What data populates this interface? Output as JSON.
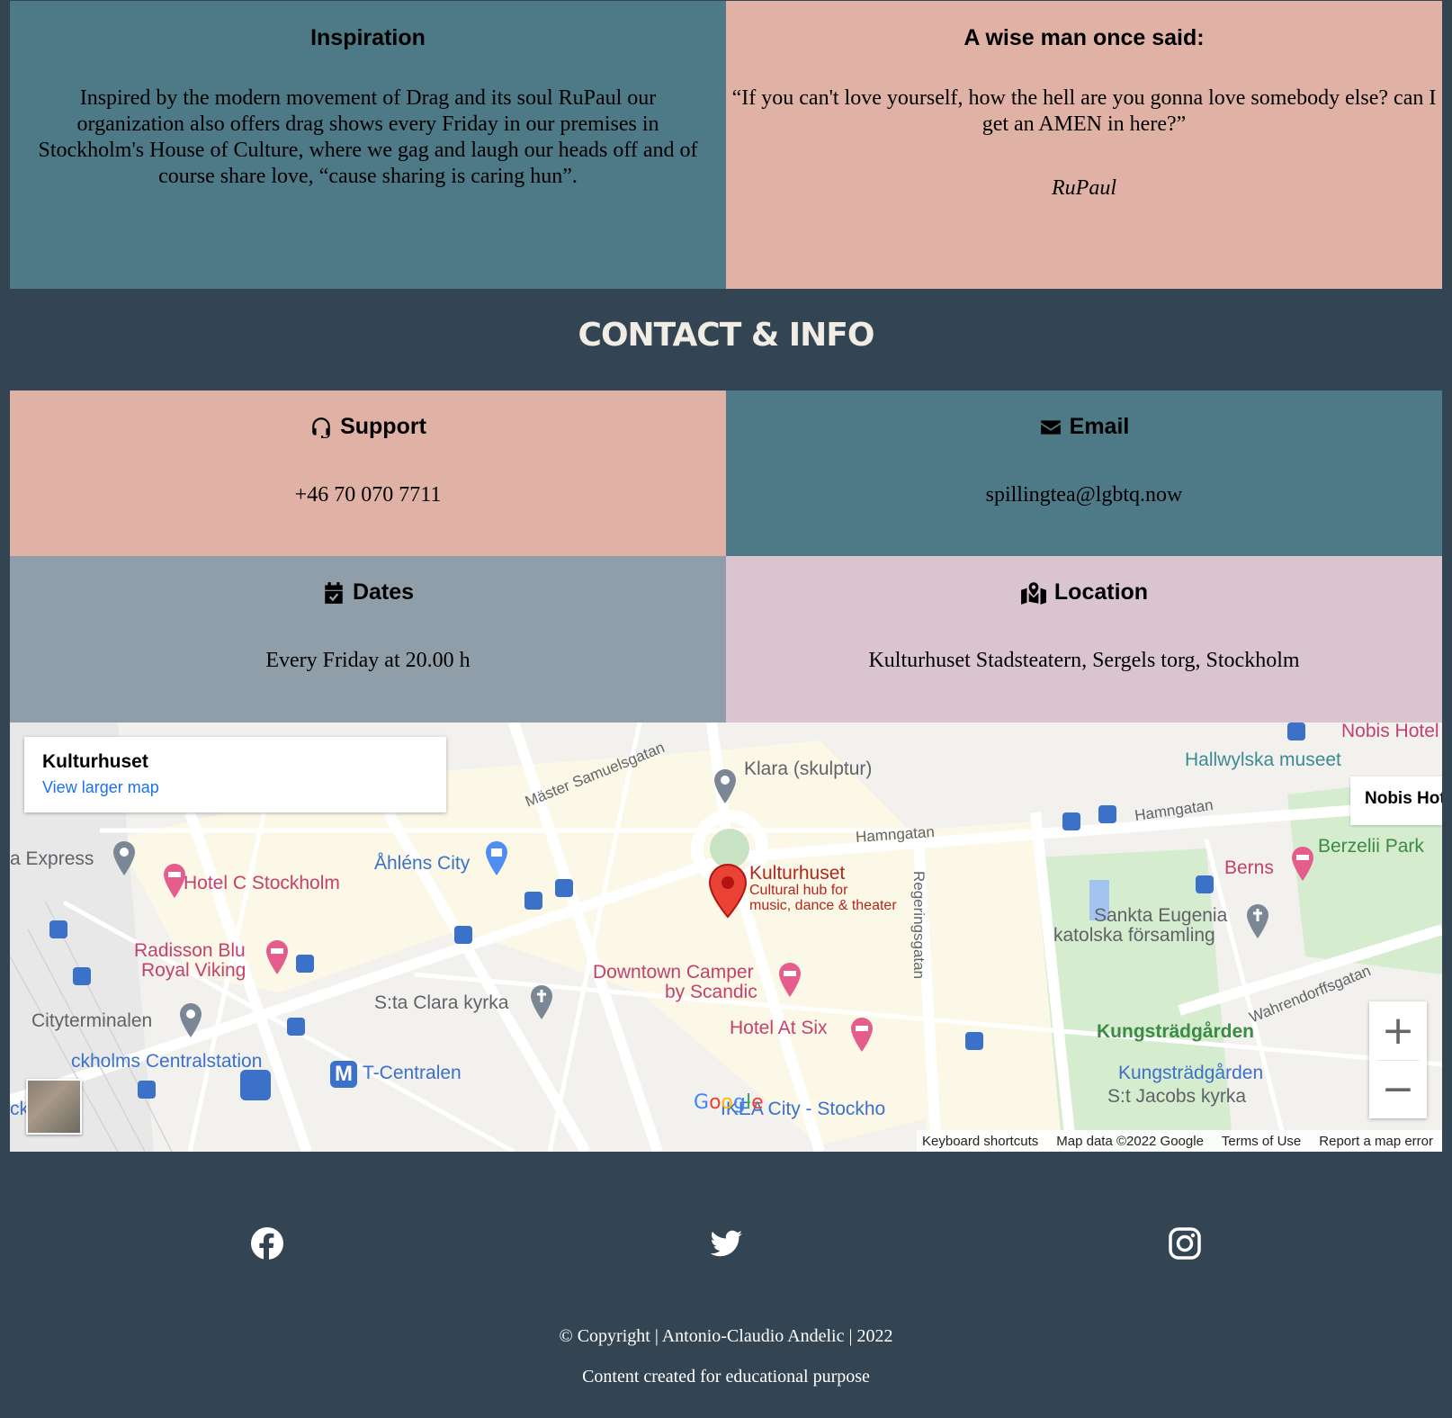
{
  "inspiration": {
    "title": "Inspiration",
    "text": "Inspired by the modern movement of Drag and its soul RuPaul our organization also offers drag shows every Friday in our premises in Stockholm's House of Culture, where we gag and laugh our heads off and of course share love, “cause sharing is caring hun”."
  },
  "quote": {
    "title": "A wise man once said:",
    "text": "“If you can't love yourself, how the hell are you gonna love somebody else? can I get an AMEN in here?”",
    "author": "RuPaul"
  },
  "contact": {
    "title": "CONTACT & INFO",
    "support": {
      "title": "Support",
      "value": "+46 70 070 7711",
      "icon": "headset-icon"
    },
    "email": {
      "title": "Email",
      "value": "spillingtea@lgbtq.now",
      "icon": "envelope-icon"
    },
    "dates": {
      "title": "Dates",
      "value": "Every Friday at 20.00 h",
      "icon": "calendar-check-icon"
    },
    "location": {
      "title": "Location",
      "value": "Kulturhuset Stadsteatern, Sergels torg, Stockholm",
      "icon": "map-location-icon"
    }
  },
  "map": {
    "card_title": "Kulturhuset",
    "card_link": "View larger map",
    "side_card": "Nobis Hotel",
    "marker_title": "Kulturhuset",
    "marker_sub1": "Cultural hub for",
    "marker_sub2": "music, dance & theater",
    "labels": {
      "klara": "Klara (skulptur)",
      "master": "Mäster Samuelsgatan",
      "hamngatan1": "Hamngatan",
      "hamngatan2": "Hamngatan",
      "regeringsgatan": "Regeringsgatan",
      "hallwylska": "Hallwylska museet",
      "nobis": "Nobis Hotel",
      "berzelii": "Berzelii Park",
      "berns": "Berns",
      "sankta1": "Sankta Eugenia",
      "sankta2": "katolska församling",
      "wahren": "Wahrendorffsgatan",
      "kungstradgarden": "Kungsträdgården",
      "kungst_station": "Kungsträdgården",
      "stjacobs": "S:t Jacobs kyrka",
      "ahlens": "Åhléns City",
      "hotelc": "Hotel C Stockholm",
      "express": "a Express",
      "radisson1": "Radisson Blu",
      "radisson2": "Royal Viking",
      "downtown1": "Downtown Camper",
      "downtown2": "by Scandic",
      "atsix": "Hotel At Six",
      "stclara": "S:ta Clara kyrka",
      "cityterminalen": "Cityterminalen",
      "centralstation": "ckholms Centralstation",
      "tcentralen": "T-Centralen",
      "ikea": "IKEA City - Stockho",
      "ckholm": "ckholm"
    },
    "zoom_in": "+",
    "zoom_out": "−",
    "logo": "Google",
    "attrib": {
      "shortcuts": "Keyboard shortcuts",
      "data": "Map data ©2022 Google",
      "terms": "Terms of Use",
      "report": "Report a map error"
    }
  },
  "footer": {
    "icons": [
      "facebook-icon",
      "twitter-icon",
      "instagram-icon"
    ],
    "copyright": "Copyright | Antonio-Claudio Andelic | 2022",
    "copyright_symbol": "©",
    "note": "Content created for educational purpose"
  },
  "colors": {
    "background": "#334553",
    "teal": "#4e7987",
    "salmon": "#e0b2a6",
    "slate": "#8f9ea9",
    "lilac": "#dac4d0"
  }
}
